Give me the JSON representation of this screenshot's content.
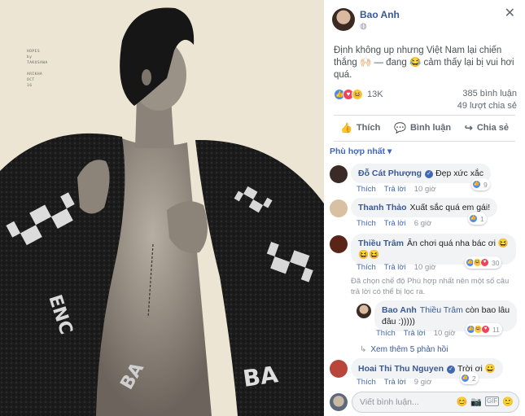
{
  "photo": {
    "credit": [
      "HOPES",
      "by",
      "TAKUSAWA",
      "",
      "ARIKHA",
      "OCT",
      "16"
    ]
  },
  "post": {
    "author": "Bao Anh",
    "privacy_icon": "globe-icon",
    "close_icon": "close-icon",
    "caption": "Định không up nhưng Việt Nam lại chiến thắng 🙌🏻 — đang 😂 cảm thấy lại bị vui hơi quá.",
    "reaction_count": "13K",
    "comment_count": "385 bình luận",
    "share_count": "49 lượt chia sẻ",
    "actions": [
      {
        "label": "Thích",
        "icon": "thumbs-up-icon"
      },
      {
        "label": "Bình luận",
        "icon": "comment-icon"
      },
      {
        "label": "Chia sẻ",
        "icon": "share-icon"
      }
    ],
    "filter_label": "Phù hợp nhất ▾"
  },
  "comments": [
    {
      "name": "Đỗ Cát Phượng",
      "verified": true,
      "text": "Đẹp xức xắc",
      "like": "Thích",
      "reply": "Trả lời",
      "time": "10 giờ",
      "reactions": "9",
      "avatar_color": "#3b2b26"
    },
    {
      "name": "Thanh Thảo",
      "verified": false,
      "text": "Xuất sắc quá em gái!",
      "like": "Thích",
      "reply": "Trả lời",
      "time": "6 giờ",
      "reactions": "1",
      "avatar_color": "#d8c1a3"
    },
    {
      "name": "Thiều Trâm",
      "verified": false,
      "text": "Ăn chơi quá nha bác ơi 😆",
      "line2": "😆😆",
      "like": "Thích",
      "reply": "Trả lời",
      "time": "10 giờ",
      "reactions": "30",
      "avatar_color": "#5a2416"
    },
    {
      "name": "Hoai Thi Thu Nguyen",
      "verified": true,
      "text": "Trời ơi 😀",
      "like": "Thích",
      "reply": "Trả lời",
      "time": "9 giờ",
      "reactions": "2",
      "avatar_color": "#b9463a"
    }
  ],
  "filter_note": "Đã chọn chế độ Phù hợp nhất nên một số câu trả lời có thể bị lọc ra.",
  "reply": {
    "name": "Bao Anh",
    "mention": "Thiều Trâm",
    "text": "còn bao lâu",
    "line2": "đâu :)))))",
    "like": "Thích",
    "reply": "Trả lời",
    "time": "10 giờ",
    "reactions": "11"
  },
  "more_replies": "Xem thêm 5 phản hồi",
  "composer": {
    "placeholder": "Viết bình luận...",
    "tools": [
      "😊",
      "📷",
      "GIF",
      "🙂"
    ]
  }
}
